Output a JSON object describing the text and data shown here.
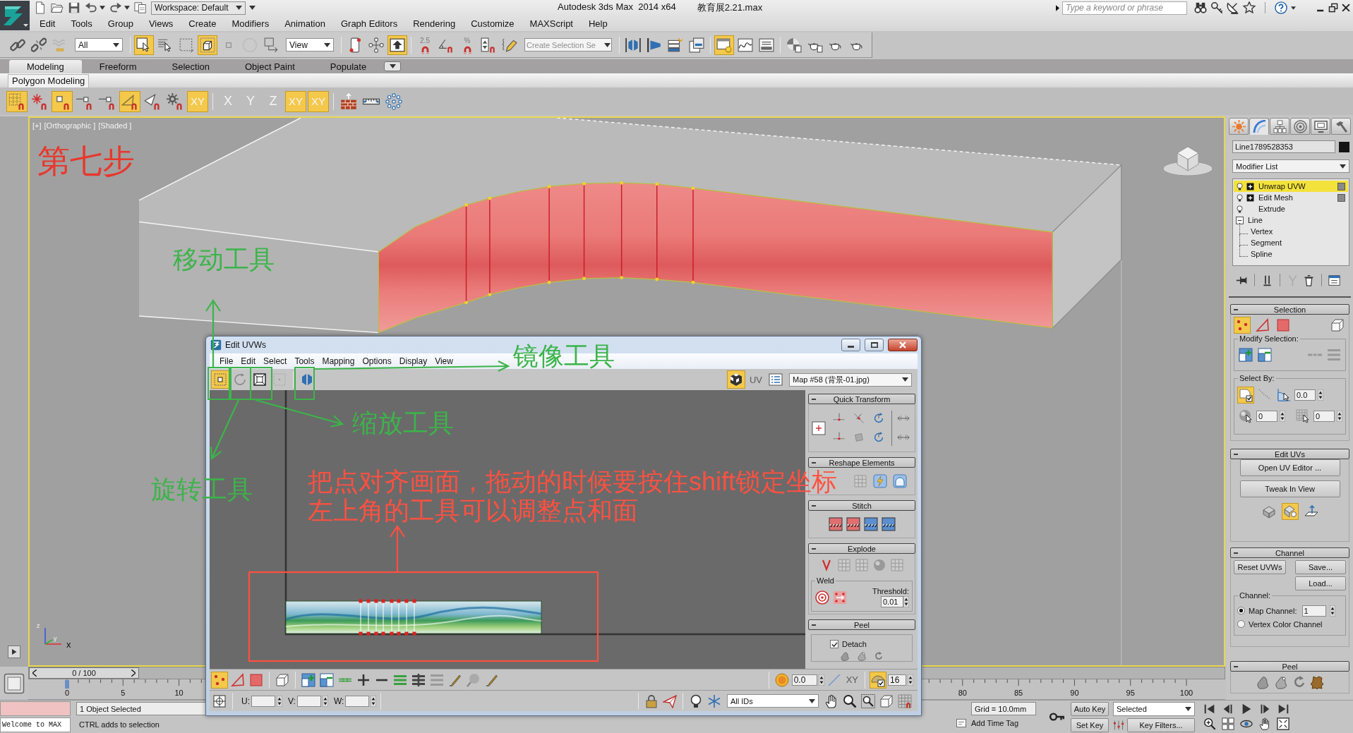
{
  "title_bar": {
    "workspace": "Workspace: Default",
    "app_title": "Autodesk 3ds Max  2014 x64",
    "file_name": "教育展2.21.max",
    "search": {
      "placeholder": "Type a keyword or phrase"
    }
  },
  "menu": [
    "Edit",
    "Tools",
    "Group",
    "Views",
    "Create",
    "Modifiers",
    "Animation",
    "Graph Editors",
    "Rendering",
    "Customize",
    "MAXScript",
    "Help"
  ],
  "main_toolbar": {
    "selection_filter": "All",
    "reference_coordinates": "View",
    "named_selection_set": {
      "placeholder": "Create Selection Se"
    },
    "groups": [
      [
        {
          "on": false
        },
        {
          "on": false
        },
        {
          "on": false
        }
      ],
      [
        {
          "on": true
        },
        {
          "on": false
        },
        {
          "on": false
        },
        {
          "on": true
        }
      ],
      [
        {
          "on": false
        },
        {
          "on": false
        },
        {
          "on": false
        }
      ],
      [
        {
          "on": false
        },
        {
          "on": false
        },
        {
          "on": true
        }
      ],
      [
        {
          "label": "2.5",
          "on": false
        },
        {
          "on": false
        },
        {
          "label": "%",
          "on": false
        },
        {
          "on": false
        }
      ],
      [
        {
          "on": false
        }
      ],
      [
        {
          "on": false
        },
        {
          "on": false
        },
        {
          "on": false
        },
        {
          "on": false
        }
      ],
      [
        {
          "on": true
        },
        {
          "on": false
        },
        {
          "on": false
        }
      ],
      [
        {
          "on": false
        },
        {
          "on": false
        },
        {
          "on": false
        },
        {
          "on": false
        }
      ]
    ]
  },
  "ribbon": {
    "tabs": [
      {
        "label": "Modeling",
        "selected": true
      },
      {
        "label": "Freeform",
        "selected": false
      },
      {
        "label": "Selection",
        "selected": false
      },
      {
        "label": "Object Paint",
        "selected": false
      },
      {
        "label": "Populate",
        "selected": false
      }
    ],
    "panel_title": "Polygon Modeling",
    "tools": [
      [
        {
          "on": true
        },
        {
          "on": false
        },
        {
          "on": true
        },
        {
          "on": false
        },
        {
          "on": false
        },
        {
          "on": true
        },
        {
          "on": false
        },
        {
          "on": false
        },
        {
          "label": "XY",
          "on": true
        }
      ],
      [
        {
          "label": "X",
          "on": false
        },
        {
          "label": "Y",
          "on": false
        },
        {
          "label": "Z",
          "on": false
        },
        {
          "label": "XY",
          "on": true
        },
        {
          "label": "XY",
          "on": true
        }
      ],
      [
        {
          "on": false
        },
        {
          "on": false
        },
        {
          "on": false
        }
      ]
    ]
  },
  "viewport": {
    "active": true,
    "labels": [
      "[+]",
      "[Orthographic ]",
      "[Shaded ]"
    ],
    "axes": [
      "z",
      "y",
      "x"
    ]
  },
  "time_slider": {
    "position": "0 / 100",
    "level": 0
  },
  "track_bar": {
    "start_labels": [
      "0",
      "5",
      "10"
    ],
    "end_labels": [
      "80",
      "85",
      "90",
      "95",
      "100"
    ]
  },
  "command_panel": {
    "tabs": [
      {
        "selected": false
      },
      {
        "selected": true
      },
      {
        "selected": false
      },
      {
        "selected": false
      },
      {
        "selected": false
      },
      {
        "selected": false
      }
    ],
    "object_name": "Line1789528353",
    "modifier_list": "Modifier List",
    "stack": [
      {
        "label": "Unwrap UVW",
        "kind": "modifier",
        "selected": true,
        "expanded": false
      },
      {
        "label": "Edit Mesh",
        "kind": "modifier",
        "selected": false,
        "expanded": false
      },
      {
        "label": "Extrude",
        "kind": "modifier",
        "selected": false
      },
      {
        "label": "Line",
        "kind": "object",
        "selected": false,
        "expanded": true,
        "children": [
          {
            "label": "Vertex",
            "selected": false
          },
          {
            "label": "Segment",
            "selected": false
          },
          {
            "label": "Spline",
            "selected": false
          }
        ]
      }
    ],
    "selection": {
      "title": "Selection",
      "levels": [
        {
          "on": true
        },
        {
          "on": false
        },
        {
          "on": false
        },
        {
          "on": false
        }
      ],
      "modify_label": "Modify Selection:",
      "select_by_label": "Select By:",
      "select_by": [
        {
          "on": true
        },
        {
          "on": false
        },
        {
          "on": false
        }
      ],
      "angle": "0.0",
      "values": [
        "0",
        "0"
      ]
    },
    "edit_uvs": {
      "title": "Edit UVs",
      "buttons": [
        "Open UV Editor ...",
        "Tweak In View"
      ],
      "tools": [
        {
          "on": false
        },
        {
          "on": true
        },
        {
          "on": false
        }
      ]
    },
    "channel": {
      "title": "Channel",
      "buttons": [
        "Reset UVWs",
        "Save...",
        "Load..."
      ],
      "group_label": "Channel:",
      "options": [
        {
          "label": "Map Channel:",
          "selected": true,
          "value": "1"
        },
        {
          "label": "Vertex Color Channel",
          "selected": false
        }
      ]
    },
    "peel": {
      "title": "Peel"
    }
  },
  "status_bar": {
    "listener": "Welcome to MAX",
    "selection": "1 Object Selected",
    "prompt": "CTRL adds to selection",
    "grid": "Grid = 10.0mm",
    "time_tag": "Add Time Tag",
    "auto_key": "Auto Key",
    "key_mode": "Selected",
    "set_key": "Set Key",
    "key_filters": "Key Filters..."
  },
  "uv_editor": {
    "title": "Edit UVWs",
    "menu": [
      "File",
      "Edit",
      "Select",
      "Tools",
      "Mapping",
      "Options",
      "Display",
      "View"
    ],
    "tools": [
      {
        "on": true
      },
      {
        "on": false
      },
      {
        "on": false
      },
      {
        "on": false
      },
      {
        "on": false
      }
    ],
    "display_toggle": {
      "on": true
    },
    "uv_button": {
      "label": "UV",
      "disabled": true
    },
    "map": "Map #58 (背景-01.jpg)",
    "quick_transform": {
      "title": "Quick Transform"
    },
    "reshape": {
      "title": "Reshape Elements"
    },
    "stitch": {
      "title": "Stitch"
    },
    "explode": {
      "title": "Explode",
      "weld_label": "Weld",
      "threshold_label": "Threshold:",
      "threshold": "0.01"
    },
    "peel": {
      "title": "Peel",
      "detach": {
        "label": "Detach",
        "checked": true
      }
    },
    "subobject": [
      {
        "on": true
      },
      {
        "on": false
      },
      {
        "on": false
      },
      {
        "on": false
      }
    ],
    "soft_falloff": "0.0",
    "axis": {
      "label": "XY",
      "disabled": true
    },
    "snap": {
      "on": true,
      "value": "16"
    },
    "coordinates": [
      "U:",
      "V:",
      "W:"
    ],
    "id_filter": "All IDs"
  },
  "annotations": [
    {
      "text": "第七步",
      "color": "#e8372c"
    },
    {
      "text": "移动工具",
      "color": "#3cb44a"
    },
    {
      "text": "旋转工具",
      "color": "#3cb44a"
    },
    {
      "text": "镜像工具",
      "color": "#3cb44a"
    },
    {
      "text": "缩放工具",
      "color": "#3cb44a"
    },
    {
      "text": "把点对齐画面，拖动的时候要按住shift锁定坐标",
      "color": "#ff5040"
    },
    {
      "text": "左上角的工具可以调整点和面",
      "color": "#ff5040"
    }
  ]
}
